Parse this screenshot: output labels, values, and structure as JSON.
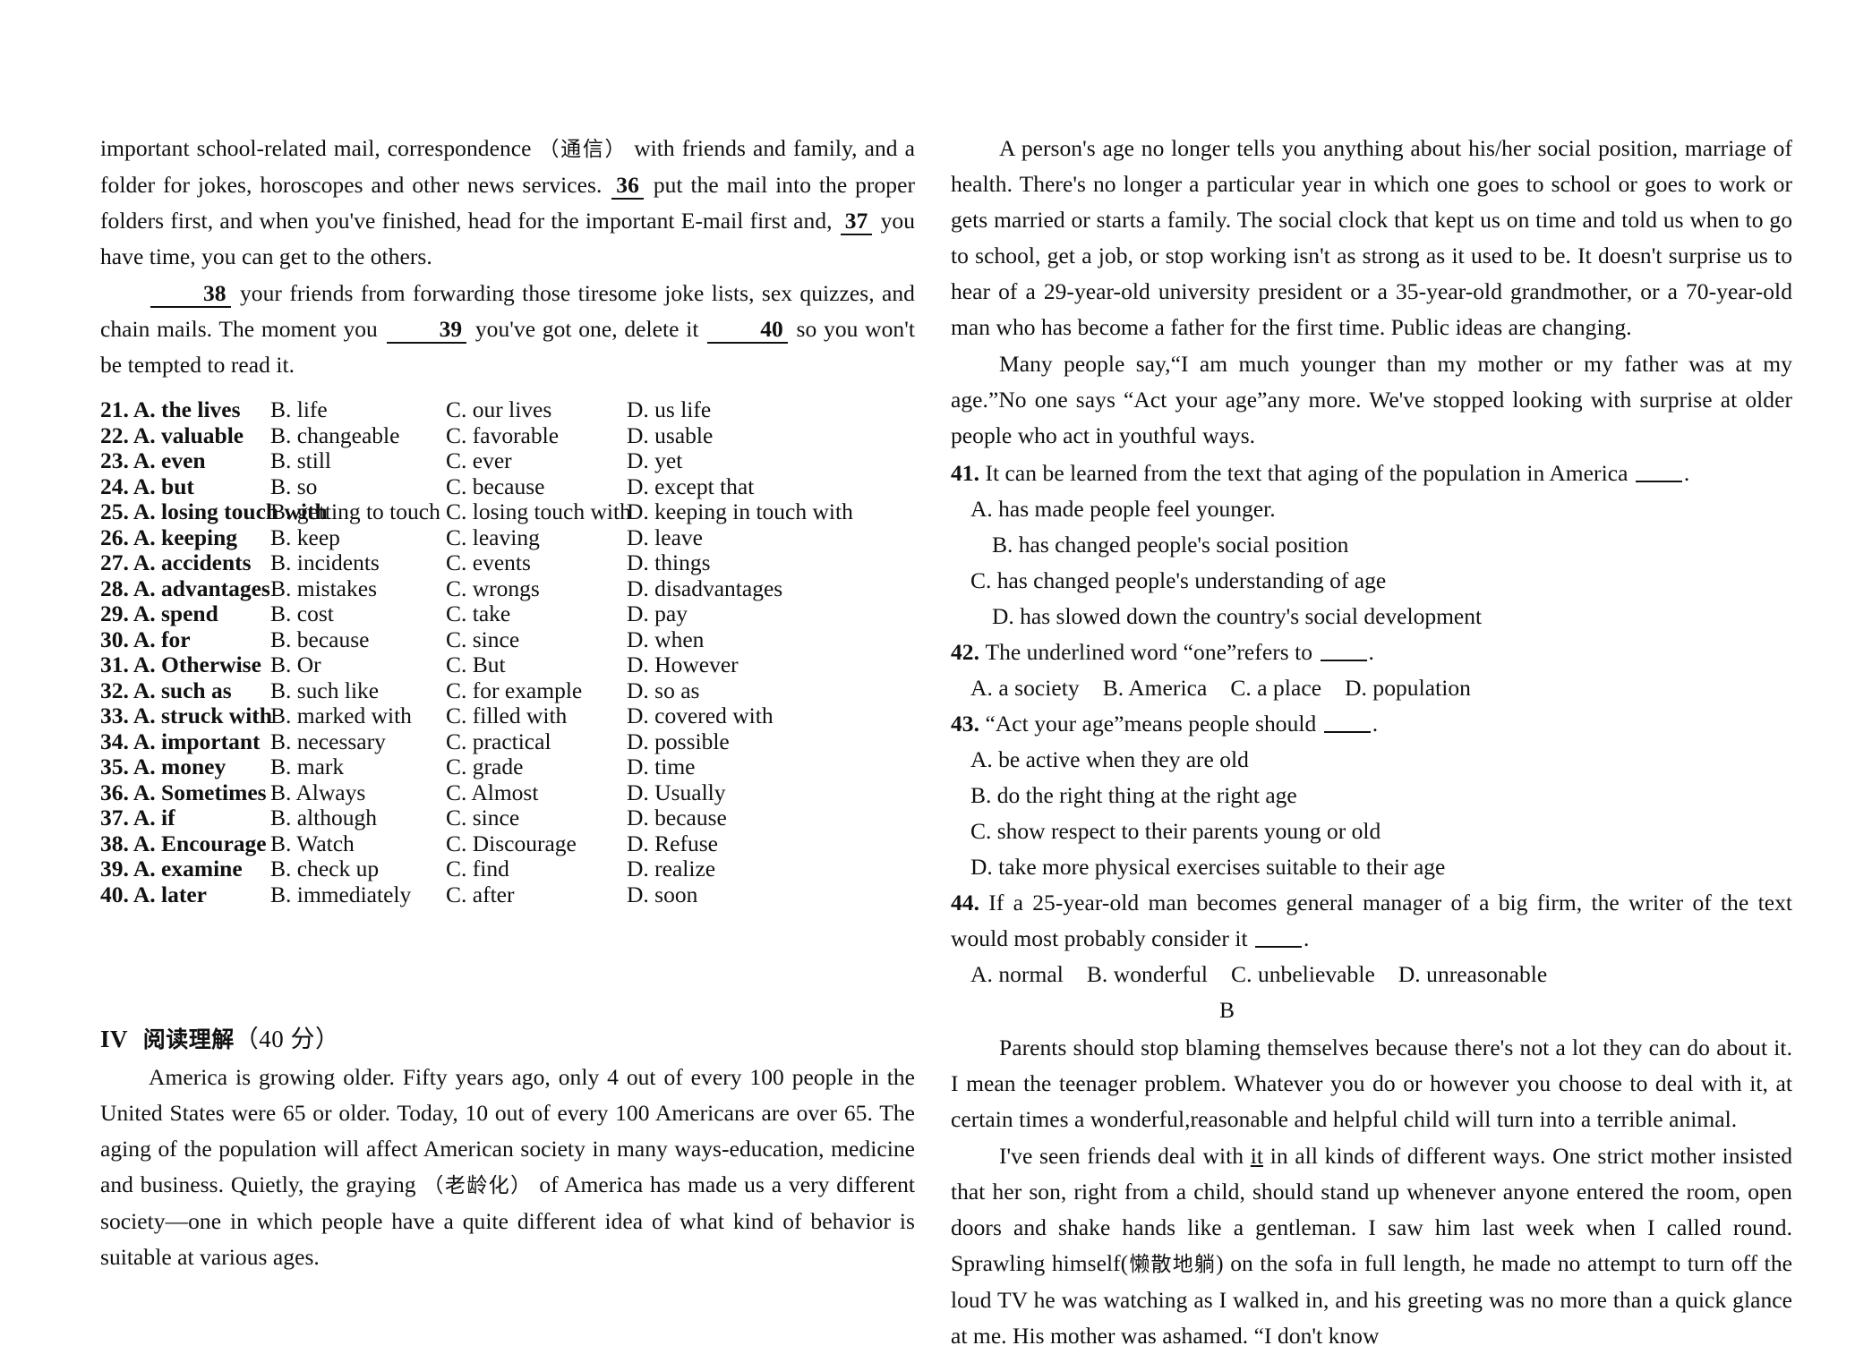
{
  "left_column": {
    "cloze_passage": {
      "para1_segments": [
        {
          "type": "text",
          "value": "important school-related mail, correspondence "
        },
        {
          "type": "cn",
          "value": "（通信）"
        },
        {
          "type": "text",
          "value": " with friends and family, and a folder for jokes, horoscopes and other news services. "
        },
        {
          "type": "blank",
          "value": "36"
        },
        {
          "type": "text",
          "value": " put the mail into the proper folders first, and when you've finished, head for the important E-mail first and, "
        },
        {
          "type": "blank",
          "value": "37"
        },
        {
          "type": "text",
          "value": " you have time, you can get to the others."
        }
      ],
      "para2_segments": [
        {
          "type": "blank",
          "value": "38"
        },
        {
          "type": "text",
          "value": " your friends from forwarding those tiresome joke lists, sex quizzes, and chain mails. The moment you "
        },
        {
          "type": "blank",
          "value": "39"
        },
        {
          "type": "text",
          "value": " you've got one, delete it "
        },
        {
          "type": "blank",
          "value": "40"
        },
        {
          "type": "text",
          "value": " so you won't be tempted to read it."
        }
      ]
    },
    "cloze_options": [
      {
        "num": "21.",
        "a": "A. the lives",
        "b": "B. life",
        "c": "C. our lives",
        "d": "D. us life"
      },
      {
        "num": "22.",
        "a": "A. valuable",
        "b": "B. changeable",
        "c": "C. favorable",
        "d": "D. usable"
      },
      {
        "num": "23.",
        "a": "A. even",
        "b": "B. still",
        "c": "C. ever",
        "d": "D. yet"
      },
      {
        "num": "24.",
        "a": "A. but",
        "b": "B. so",
        "c": "C. because",
        "d": "D. except that"
      },
      {
        "num": "25.",
        "a": "A. losing touch with",
        "b": "B. getting to touch",
        "c": "C. losing touch with",
        "d": "D. keeping in touch with"
      },
      {
        "num": "26.",
        "a": "A. keeping",
        "b": "B. keep",
        "c": "C. leaving",
        "d": "D. leave"
      },
      {
        "num": "27.",
        "a": "A. accidents",
        "b": "B. incidents",
        "c": "C. events",
        "d": "D. things"
      },
      {
        "num": "28.",
        "a": "A. advantages",
        "b": "B. mistakes",
        "c": "C. wrongs",
        "d": "D. disadvantages"
      },
      {
        "num": "29.",
        "a": "A. spend",
        "b": "B. cost",
        "c": "C. take",
        "d": "D. pay"
      },
      {
        "num": "30.",
        "a": "A. for",
        "b": "B. because",
        "c": "C. since",
        "d": "D. when"
      },
      {
        "num": "31.",
        "a": "A. Otherwise",
        "b": "B. Or",
        "c": "C. But",
        "d": "D. However"
      },
      {
        "num": "32.",
        "a": "A. such as",
        "b": "B. such like",
        "c": "C. for example",
        "d": "D. so as"
      },
      {
        "num": "33.",
        "a": "A. struck with",
        "b": "B. marked with",
        "c": "C. filled with",
        "d": "D. covered with"
      },
      {
        "num": "34.",
        "a": "A. important",
        "b": "B. necessary",
        "c": "C. practical",
        "d": "D. possible"
      },
      {
        "num": "35.",
        "a": "A. money",
        "b": "B. mark",
        "c": "C. grade",
        "d": "D. time"
      },
      {
        "num": "36.",
        "a": "A. Sometimes",
        "b": "B. Always",
        "c": "C. Almost",
        "d": "D. Usually"
      },
      {
        "num": "37.",
        "a": "A. if",
        "b": "B. although",
        "c": "C. since",
        "d": "D. because"
      },
      {
        "num": "38.",
        "a": "A. Encourage",
        "b": "B. Watch",
        "c": "C. Discourage",
        "d": "D. Refuse"
      },
      {
        "num": "39.",
        "a": "A. examine",
        "b": "B. check up",
        "c": "C. find",
        "d": "D. realize"
      },
      {
        "num": "40.",
        "a": "A. later",
        "b": "B. immediately",
        "c": "C. after",
        "d": "D. soon"
      }
    ],
    "section": {
      "numeral": "IV",
      "title_cn": "阅读理解",
      "score": "（40 分）"
    },
    "reading_passage_a_segments": [
      {
        "type": "text",
        "value": "America is growing older. Fifty years ago, only 4 out of every 100 people in the United States were 65 or older. Today, 10 out of every 100 Americans are over 65. The aging of the population will affect American society in many ways-education, medicine and business. Quietly, the graying "
      },
      {
        "type": "cn",
        "value": "（老龄化）"
      },
      {
        "type": "text",
        "value": " of America has made us a very different society—one in which people have a quite different idea of what kind of behavior is suitable at various ages."
      }
    ]
  },
  "right_column": {
    "passage_a": {
      "para1": "A person's age no longer tells you anything about his/her social position, marriage of health. There's no longer a particular year in which one goes to school or goes to work or gets married or starts a family. The social clock that kept us on time and told us when to go to school, get a job, or stop working isn't as strong as it used to be. It doesn't surprise us to hear of a 29-year-old university president or a 35-year-old grandmother, or a 70-year-old man who has become a father for the first time. Public ideas are changing.",
      "para2": "Many people say,“I am much younger than my mother or my father was at my age.”No one says “Act your age”any more. We've stopped looking with surprise at older people who act in youthful ways."
    },
    "questions": [
      {
        "num": "41.",
        "stem": "It can be learned from the text that aging of the population in America",
        "after": ".",
        "layout": "stacked",
        "choices": [
          {
            "label": "A. has made people feel younger.",
            "indent": 1
          },
          {
            "label": "B. has changed people's social position",
            "indent": 2
          },
          {
            "label": "C. has changed people's understanding of age",
            "indent": 1
          },
          {
            "label": "D. has slowed down the country's social development",
            "indent": 2
          }
        ]
      },
      {
        "num": "42.",
        "stem": "The underlined word “one”refers to",
        "after": ".",
        "layout": "inline",
        "choices": [
          {
            "label": "A. a society"
          },
          {
            "label": "B. America"
          },
          {
            "label": "C. a place"
          },
          {
            "label": "D. population"
          }
        ]
      },
      {
        "num": "43.",
        "stem": "“Act your age”means people should",
        "after": ".",
        "layout": "stacked",
        "choices": [
          {
            "label": "A. be active when they are old",
            "indent": 1
          },
          {
            "label": "B. do the right thing at the right age",
            "indent": 1
          },
          {
            "label": "C. show respect to their parents young or old",
            "indent": 1
          },
          {
            "label": "D. take more physical exercises suitable to their age",
            "indent": 1
          }
        ]
      },
      {
        "num": "44.",
        "stem": "If a 25-year-old man becomes general manager of a big firm, the writer of the text would most probably consider it",
        "after": ".",
        "layout": "inline",
        "choices": [
          {
            "label": "A. normal"
          },
          {
            "label": "B. wonderful"
          },
          {
            "label": "C. unbelievable"
          },
          {
            "label": "D. unreasonable"
          }
        ]
      }
    ],
    "passage_b_label": "B",
    "passage_b": {
      "para1": "Parents should stop blaming themselves because there's not a lot they can do about it. I mean the teenager problem. Whatever you do or however you choose to deal with it, at certain times a wonderful,reasonable and helpful child will turn into a terrible animal.",
      "para2_segments": [
        {
          "type": "text",
          "value": "I've seen friends deal with "
        },
        {
          "type": "underline",
          "value": "it"
        },
        {
          "type": "text",
          "value": " in all kinds of different ways. One strict mother insisted that her son, right from a child, should stand up whenever anyone entered the room, open doors and shake hands like a gentleman. I saw him last week when I called round. Sprawling himself("
        },
        {
          "type": "cn",
          "value": "懒散地躺"
        },
        {
          "type": "text",
          "value": ") on the sofa in full length, he made no attempt to turn off the loud TV he was watching as I walked in, and his greeting was no more than a quick glance at me. His mother was ashamed. “I don't know"
        }
      ]
    }
  }
}
